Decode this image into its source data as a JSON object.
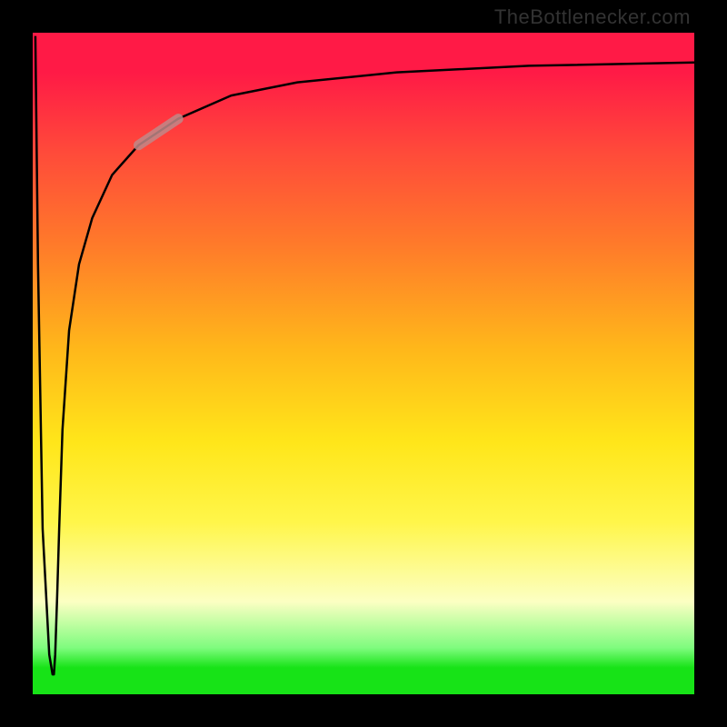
{
  "watermark": {
    "text": "TheBottlenecker.com"
  },
  "chart_data": {
    "type": "line",
    "title": "",
    "xlabel": "",
    "ylabel": "",
    "xlim": [
      0,
      100
    ],
    "ylim": [
      0,
      100
    ],
    "background_gradient": {
      "direction": "vertical",
      "stops": [
        {
          "pos": 0,
          "color": "#ff1a46"
        },
        {
          "pos": 0.5,
          "color": "#ffe61a"
        },
        {
          "pos": 0.93,
          "color": "#7efc7e"
        },
        {
          "pos": 1.0,
          "color": "#17e317"
        }
      ]
    },
    "series": [
      {
        "name": "bottleneck-curve",
        "color": "#000000",
        "x": [
          0.4,
          0.8,
          1.5,
          2.5,
          3.0,
          3.2,
          3.4,
          3.7,
          4.0,
          4.5,
          5.5,
          7.0,
          9.0,
          12.0,
          16.0,
          22.0,
          30.0,
          40.0,
          55.0,
          75.0,
          100.0
        ],
        "y": [
          99.5,
          65.0,
          25.0,
          6.0,
          3.0,
          3.0,
          6.0,
          15.0,
          25.0,
          40.0,
          55.0,
          65.0,
          72.0,
          78.5,
          83.0,
          87.0,
          90.5,
          92.5,
          94.0,
          95.0,
          95.5
        ]
      },
      {
        "name": "highlight-segment",
        "color": "#c08888",
        "stroke_width": 11,
        "opacity": 0.85,
        "x": [
          16.0,
          22.0
        ],
        "y": [
          83.0,
          87.0
        ]
      }
    ]
  }
}
